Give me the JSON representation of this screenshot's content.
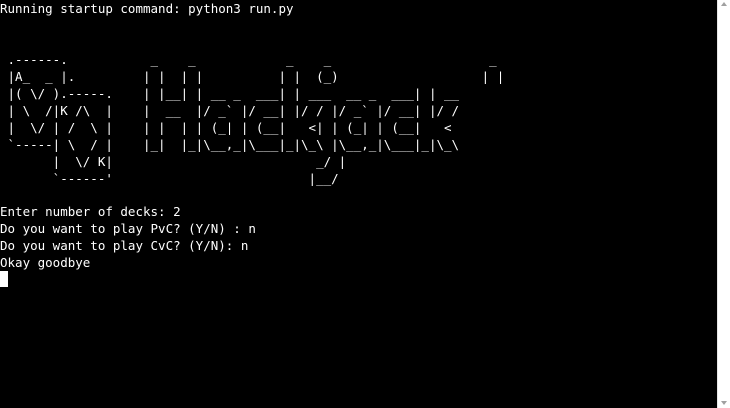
{
  "terminal": {
    "startup_line": "Running startup command: python3 run.py",
    "ascii_art": [
      " .------.           _    _            _    _                     _",
      " |A_  _ |.         | |  | |          | |  (_)                   | |",
      " |( \\/ ).-----.    | |__| | __ _  ___| | ___  __ _  ___| | __",
      " | \\  /|K /\\  |    |  __  |/ _` |/ __| |/ / |/ _` |/ __| |/ /",
      " |  \\/ | /  \\ |    | |  | | (_| | (__|   <| | (_| | (__|   <",
      " `-----| \\  / |    |_|  |_|\\__,_|\\___|_|\\_\\ |\\__,_|\\___|_|\\_\\",
      "       |  \\/ K|                           _/ |",
      "       `------'                          |__/"
    ],
    "io_lines": [
      "Enter number of decks: 2",
      "Do you want to play PvC? (Y/N) : n",
      "Do you want to play CvC? (Y/N): n",
      "Okay goodbye"
    ]
  }
}
